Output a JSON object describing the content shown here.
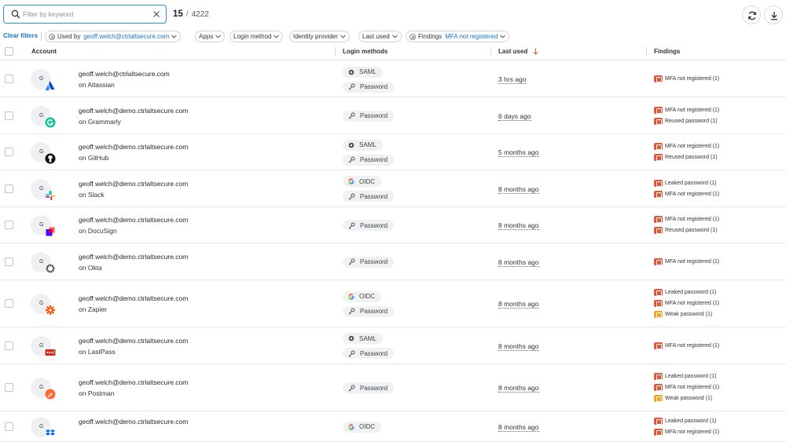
{
  "search": {
    "placeholder": "Filter by keyword",
    "value": ""
  },
  "count": {
    "shown": "15",
    "separator": "/",
    "total": "4222"
  },
  "toolbar": {
    "refresh_icon": "refresh-icon",
    "download_icon": "download-icon"
  },
  "filters": {
    "clear_label": "Clear filters",
    "used_by": {
      "label": "Used by",
      "value": "geoff.welch@ctrlaltsecure.com"
    },
    "apps": "Apps",
    "login_method": "Login method",
    "identity_provider": "Identity provider",
    "last_used": "Last used",
    "findings": {
      "label": "Findings",
      "value": "MFA not registered"
    }
  },
  "columns": {
    "account": "Account",
    "login_methods": "Login methods",
    "last_used": "Last used",
    "findings": "Findings"
  },
  "rows": [
    {
      "avatar_letter": "G",
      "email": "geoff.welch@ctrlaltsecure.com",
      "app": "on Atlassian",
      "app_icon": "atlassian-icon",
      "methods": [
        {
          "name": "SAML",
          "icon": "saml-icon"
        },
        {
          "name": "Password",
          "icon": "key-icon"
        }
      ],
      "last_used": "3 hrs ago",
      "findings": [
        {
          "text": "MFA not registered (1)",
          "level": "red"
        }
      ]
    },
    {
      "avatar_letter": "G",
      "email": "geoff.welch@demo.ctrlaltsecure.com",
      "app": "on Grammarly",
      "app_icon": "grammarly-icon",
      "methods": [
        {
          "name": "Password",
          "icon": "key-icon"
        }
      ],
      "last_used": "6 days ago",
      "findings": [
        {
          "text": "MFA not registered (1)",
          "level": "red"
        },
        {
          "text": "Reused password (1)",
          "level": "red"
        }
      ]
    },
    {
      "avatar_letter": "G",
      "email": "geoff.welch@demo.ctrlaltsecure.com",
      "app": "on GitHub",
      "app_icon": "github-icon",
      "methods": [
        {
          "name": "SAML",
          "icon": "saml-icon"
        },
        {
          "name": "Password",
          "icon": "key-icon"
        }
      ],
      "last_used": "5 months ago",
      "findings": [
        {
          "text": "MFA not registered (1)",
          "level": "red"
        },
        {
          "text": "Reused password (1)",
          "level": "red"
        }
      ]
    },
    {
      "avatar_letter": "G",
      "email": "geoff.welch@demo.ctrlaltsecure.com",
      "app": "on Slack",
      "app_icon": "slack-icon",
      "methods": [
        {
          "name": "OIDC",
          "icon": "google-icon"
        },
        {
          "name": "Password",
          "icon": "key-icon"
        }
      ],
      "last_used": "8 months ago",
      "findings": [
        {
          "text": "Leaked password (1)",
          "level": "red"
        },
        {
          "text": "MFA not registered (1)",
          "level": "red"
        }
      ]
    },
    {
      "avatar_letter": "G",
      "email": "geoff.welch@demo.ctrlaltsecure.com",
      "app": "on DocuSign",
      "app_icon": "docusign-icon",
      "methods": [
        {
          "name": "Password",
          "icon": "key-icon"
        }
      ],
      "last_used": "8 months ago",
      "findings": [
        {
          "text": "MFA not registered (1)",
          "level": "red"
        },
        {
          "text": "Reused password (1)",
          "level": "red"
        }
      ]
    },
    {
      "avatar_letter": "G",
      "email": "geoff.welch@demo.ctrlaltsecure.com",
      "app": "on Okta",
      "app_icon": "okta-icon",
      "methods": [
        {
          "name": "Password",
          "icon": "key-icon"
        }
      ],
      "last_used": "8 months ago",
      "findings": [
        {
          "text": "MFA not registered (1)",
          "level": "red"
        }
      ]
    },
    {
      "avatar_letter": "G",
      "email": "geoff.welch@demo.ctrlaltsecure.com",
      "app": "on Zapier",
      "app_icon": "zapier-icon",
      "methods": [
        {
          "name": "OIDC",
          "icon": "google-icon"
        },
        {
          "name": "Password",
          "icon": "key-icon"
        }
      ],
      "last_used": "8 months ago",
      "findings": [
        {
          "text": "Leaked password (1)",
          "level": "red"
        },
        {
          "text": "MFA not registered (1)",
          "level": "red"
        },
        {
          "text": "Weak password (1)",
          "level": "yellow"
        }
      ]
    },
    {
      "avatar_letter": "G",
      "email": "geoff.welch@demo.ctrlaltsecure.com",
      "app": "on LastPass",
      "app_icon": "lastpass-icon",
      "methods": [
        {
          "name": "SAML",
          "icon": "saml-icon"
        },
        {
          "name": "Password",
          "icon": "key-icon"
        }
      ],
      "last_used": "8 months ago",
      "findings": [
        {
          "text": "MFA not registered (1)",
          "level": "red"
        }
      ]
    },
    {
      "avatar_letter": "G",
      "email": "geoff.welch@demo.ctrlaltsecure.com",
      "app": "on Postman",
      "app_icon": "postman-icon",
      "methods": [
        {
          "name": "Password",
          "icon": "key-icon"
        }
      ],
      "last_used": "8 months ago",
      "findings": [
        {
          "text": "Leaked password (1)",
          "level": "red"
        },
        {
          "text": "MFA not registered (1)",
          "level": "red"
        },
        {
          "text": "Weak password (1)",
          "level": "yellow"
        }
      ]
    },
    {
      "avatar_letter": "G",
      "email": "geoff.welch@demo.ctrlaltsecure.com",
      "app": "",
      "app_icon": "dropbox-icon",
      "methods": [
        {
          "name": "OIDC",
          "icon": "google-icon"
        }
      ],
      "last_used": "8 months ago",
      "findings": [
        {
          "text": "Leaked password (1)",
          "level": "red"
        },
        {
          "text": "MFA not registered (1)",
          "level": "red"
        }
      ]
    }
  ],
  "colors": {
    "accent": "#1a73c7",
    "finding_red": "#e2563b",
    "finding_yellow": "#f1a52b"
  }
}
